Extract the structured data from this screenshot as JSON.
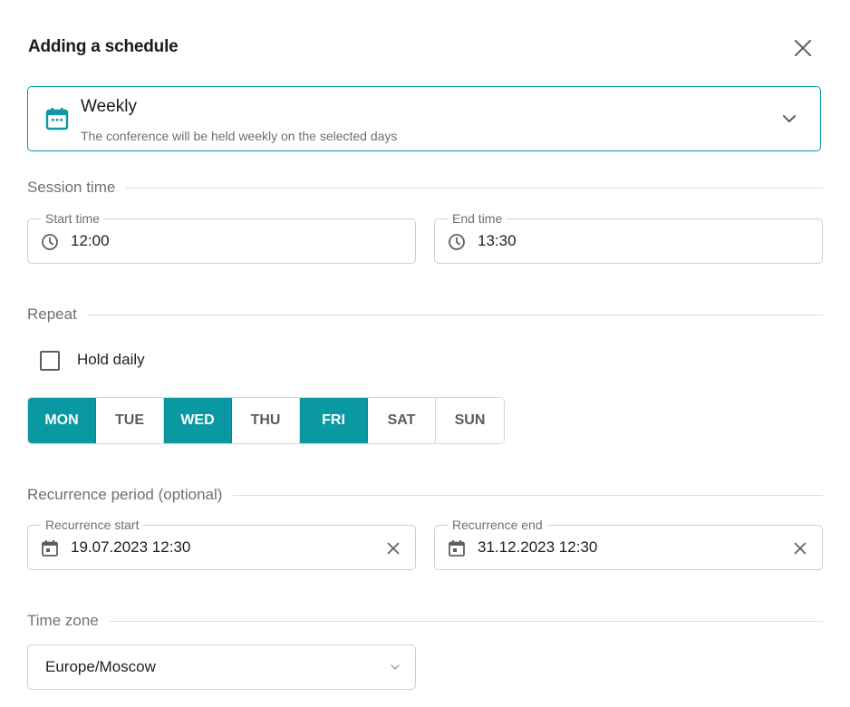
{
  "dialog": {
    "title": "Adding a schedule"
  },
  "schedule_type": {
    "name": "Weekly",
    "description": "The conference will be held weekly on the selected days",
    "accent": "#0e97a3"
  },
  "session_time": {
    "section_label": "Session time",
    "start": {
      "label": "Start time",
      "value": "12:00"
    },
    "end": {
      "label": "End time",
      "value": "13:30"
    }
  },
  "repeat": {
    "section_label": "Repeat",
    "hold_daily_label": "Hold daily",
    "hold_daily_checked": false,
    "days": [
      {
        "label": "MON",
        "selected": true
      },
      {
        "label": "TUE",
        "selected": false
      },
      {
        "label": "WED",
        "selected": true
      },
      {
        "label": "THU",
        "selected": false
      },
      {
        "label": "FRI",
        "selected": true
      },
      {
        "label": "SAT",
        "selected": false
      },
      {
        "label": "SUN",
        "selected": false
      }
    ],
    "selected_color": "#0a99a3"
  },
  "recurrence": {
    "section_label": "Recurrence period (optional)",
    "start": {
      "label": "Recurrence start",
      "value": "19.07.2023 12:30"
    },
    "end": {
      "label": "Recurrence end",
      "value": "31.12.2023 12:30"
    }
  },
  "time_zone": {
    "section_label": "Time zone",
    "value": "Europe/Moscow"
  }
}
